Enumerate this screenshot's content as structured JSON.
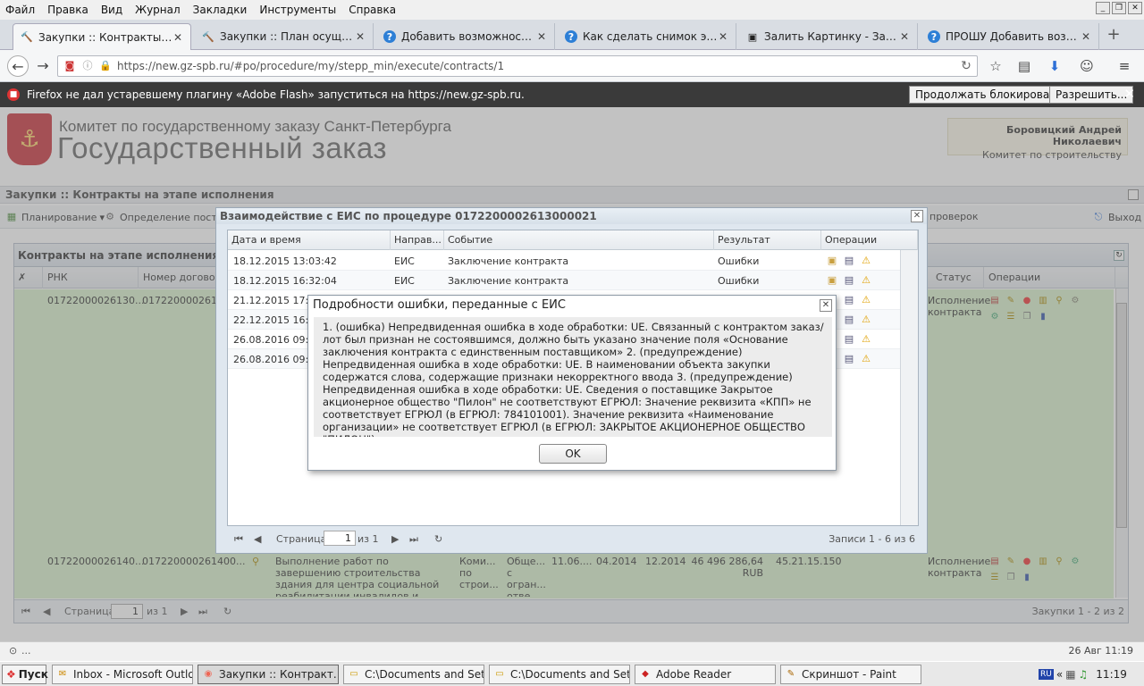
{
  "menubar": [
    "Файл",
    "Правка",
    "Вид",
    "Журнал",
    "Закладки",
    "Инструменты",
    "Справка"
  ],
  "tabs": [
    {
      "title": "Закупки :: Контракты на ..."
    },
    {
      "title": "Закупки :: План осуществ..."
    },
    {
      "title": "Добавить возможность в..."
    },
    {
      "title": "Как сделать снимок экран..."
    },
    {
      "title": "Залить Картинку - Загруз..."
    },
    {
      "title": "ПРОШУ Добавить возмож..."
    }
  ],
  "address": {
    "url": "https://new.gz-spb.ru/#po/procedure/my/stepp_min/execute/contracts/1"
  },
  "notification": {
    "text": "Firefox не дал устаревшему плагину «Adobe Flash» запуститься на https://new.gz-spb.ru.",
    "continue_label": "Продолжать блокировать",
    "allow_label": "Разрешить..."
  },
  "header": {
    "org_line1": "Комитет по государственному заказу Санкт-Петербурга",
    "org_line2": "Государственный заказ",
    "user_name": "Боровицкий Андрей Николаевич",
    "user_dept": "Комитет по строительству"
  },
  "page_title": "Закупки :: Контракты на этапе исполнения",
  "toolbar": {
    "planning": "Планирование",
    "determination": "Определение постав",
    "checks": "проверок",
    "exit": "Выход"
  },
  "contracts": {
    "title": "Контракты на этапе исполнения",
    "columns": {
      "rnk": "РНК",
      "number": "Номер договора",
      "status": "Статус",
      "ops": "Операции"
    },
    "rows": [
      {
        "rnk": "01722000026130...",
        "number": "01722000026130",
        "status": "Исполнение контракта"
      },
      {
        "rnk": "01722000026140...",
        "number": "017220000261400...",
        "subject": "Выполнение работ по завершению строительства здания для центра социальной реабилитации инвалидов и детей инвалидов по адресу: Санкт",
        "customer": "Коми... по строи...",
        "method": "с огран... отве...",
        "form": "Обще... с огран... отве...",
        "date1": "11.06....",
        "date2": "04.2014",
        "date3": "12.2014",
        "amount": "46 496 286,64 RUB",
        "okpd": "45.21.15.150",
        "status": "Исполнение контракта"
      }
    ],
    "paging": {
      "page_label": "Страница",
      "page": "1",
      "of": "из 1",
      "summary": "Закупки 1 - 2 из 2"
    }
  },
  "eis_dialog": {
    "title": "Взаимодействие с ЕИС по процедуре 0172200002613000021",
    "columns": {
      "datetime": "Дата и время",
      "direction": "Направ...",
      "event": "Событие",
      "result": "Результат",
      "ops": "Операции"
    },
    "rows": [
      {
        "datetime": "18.12.2015 13:03:42",
        "direction": "ЕИС",
        "event": "Заключение контракта",
        "result": "Ошибки"
      },
      {
        "datetime": "18.12.2015 16:32:04",
        "direction": "ЕИС",
        "event": "Заключение контракта",
        "result": "Ошибки"
      },
      {
        "datetime": "21.12.2015 17:40",
        "direction": "",
        "event": "",
        "result": ""
      },
      {
        "datetime": "22.12.2015 16:18",
        "direction": "",
        "event": "",
        "result": ""
      },
      {
        "datetime": "26.08.2016 09:41",
        "direction": "",
        "event": "",
        "result": ""
      },
      {
        "datetime": "26.08.2016 09:52",
        "direction": "",
        "event": "",
        "result": ""
      }
    ],
    "paging": {
      "page_label": "Страница",
      "page": "1",
      "of": "из 1",
      "summary": "Записи 1 - 6 из 6"
    }
  },
  "error_dialog": {
    "title": "Подробности ошибки, переданные с ЕИС",
    "body": "1. (ошибка) Непредвиденная ошибка в ходе обработки: UE. Связанный с контрактом заказ/лот был признан не состоявшимся, должно быть указано значение поля «Основание заключения контракта с единственным поставщиком» 2. (предупреждение) Непредвиденная ошибка в ходе обработки: UE. В наименовании объекта закупки содержатся слова, содержащие признаки некорректного ввода 3. (предупреждение) Непредвиденная ошибка в ходе обработки: UE. Сведения о поставщике Закрытое акционерное общество \"Пилон\" не соответствуют ЕГРЮЛ: Значение реквизита «КПП» не соответствует ЕГРЮЛ (в ЕГРЮЛ: 784101001). Значение реквизита «Наименование организации» не соответствует ЕГРЮЛ (в ЕГРЮЛ: ЗАКРЫТОЕ АКЦИОНЕРНОЕ ОБЩЕСТВО \"ПИЛОН\").",
    "ok_label": "OK"
  },
  "statusbar": {
    "left": "...",
    "right": "26 Авг 11:19"
  },
  "taskbar": {
    "start": "Пуск",
    "items": [
      "Inbox - Microsoft Outlook",
      "Закупки :: Контракт...",
      "C:\\Documents and Settin...",
      "C:\\Documents and Settin...",
      "Adobe Reader",
      "Скриншот - Paint"
    ],
    "lang": "RU",
    "clock": "11:19"
  },
  "colors": {
    "row_green": "#d9f0cc",
    "notif_bg": "#3a3a3a",
    "accent": "#2d7fd6"
  }
}
